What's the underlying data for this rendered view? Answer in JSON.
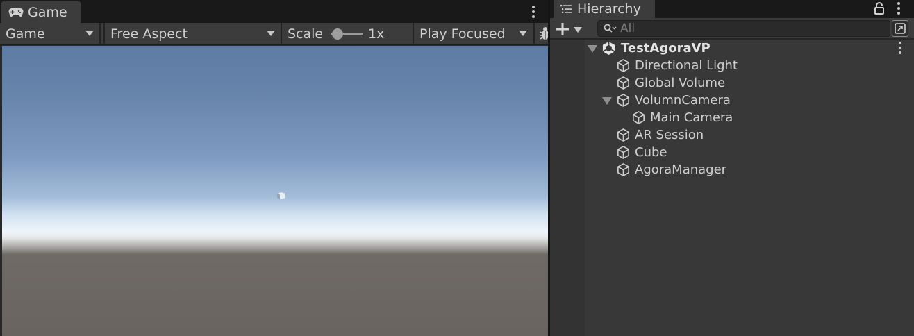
{
  "game": {
    "tab_label": "Game",
    "toolbar": {
      "display": "Game",
      "aspect": "Free Aspect",
      "scale_label": "Scale",
      "scale_value": "1x",
      "scale_fraction": 0.05,
      "play_mode": "Play Focused"
    }
  },
  "hierarchy": {
    "tab_label": "Hierarchy",
    "search": {
      "placeholder": "All",
      "value": ""
    },
    "root": "TestAgoraVP",
    "items": [
      {
        "label": "Directional Light",
        "depth": 1
      },
      {
        "label": "Global Volume",
        "depth": 1
      },
      {
        "label": "VolumnCamera",
        "depth": 1,
        "expanded": true
      },
      {
        "label": "Main Camera",
        "depth": 2
      },
      {
        "label": "AR Session",
        "depth": 1
      },
      {
        "label": "Cube",
        "depth": 1
      },
      {
        "label": "AgoraManager",
        "depth": 1
      }
    ]
  },
  "colors": {
    "panel_bg": "#383838",
    "toolbar_bg": "#3c3c3c",
    "text": "#cfcfcf"
  }
}
